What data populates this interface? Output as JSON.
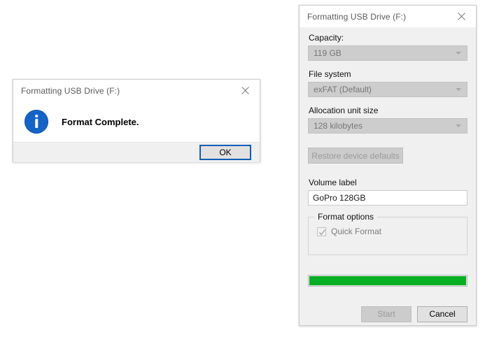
{
  "complete_dialog": {
    "title": "Formatting USB Drive (F:)",
    "close_icon": "close-icon",
    "status_icon": "info-icon",
    "message": "Format Complete.",
    "ok_label": "OK"
  },
  "format_dialog": {
    "title": "Formatting USB Drive (F:)",
    "close_icon": "close-icon",
    "capacity": {
      "label": "Capacity:",
      "value": "119 GB",
      "chevron_icon": "chevron-down-icon"
    },
    "file_system": {
      "label": "File system",
      "value": "exFAT (Default)",
      "chevron_icon": "chevron-down-icon"
    },
    "allocation_unit_size": {
      "label": "Allocation unit size",
      "value": "128 kilobytes",
      "chevron_icon": "chevron-down-icon"
    },
    "restore_defaults_label": "Restore device defaults",
    "volume_label": {
      "label": "Volume label",
      "value": "GoPro 128GB"
    },
    "format_options": {
      "legend": "Format options",
      "quick_format_label": "Quick Format",
      "quick_format_checked": true,
      "check_icon": "check-icon"
    },
    "progress": {
      "percent": 100
    },
    "start_label": "Start",
    "cancel_label": "Cancel",
    "accent_color": "#0d5fb4",
    "progress_color": "#06b025"
  }
}
